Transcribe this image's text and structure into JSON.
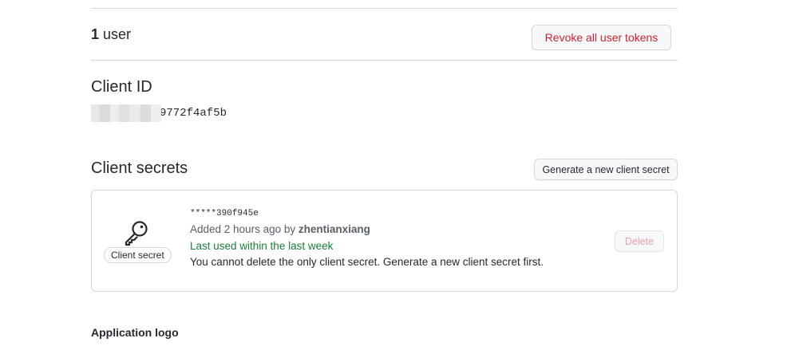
{
  "users": {
    "count": "1",
    "label": "user",
    "revoke_button": "Revoke all user tokens"
  },
  "client_id": {
    "title": "Client ID",
    "value_suffix": "9772f4af5b"
  },
  "client_secrets": {
    "title": "Client secrets",
    "generate_button": "Generate a new client secret",
    "items": [
      {
        "icon": "key-icon",
        "badge": "Client secret",
        "masked_value": "*****390f945e",
        "added_prefix": "Added 2 hours ago by",
        "added_by": "zhentianxiang",
        "last_used": "Last used within the last week",
        "note": "You cannot delete the only client secret. Generate a new client secret first.",
        "delete_button": "Delete",
        "delete_disabled": true
      }
    ]
  },
  "application_logo": {
    "title": "Application logo"
  },
  "colors": {
    "danger": "#cf222e",
    "success": "#1a7f37",
    "border": "#d0d7de",
    "muted_text": "#57606a"
  }
}
